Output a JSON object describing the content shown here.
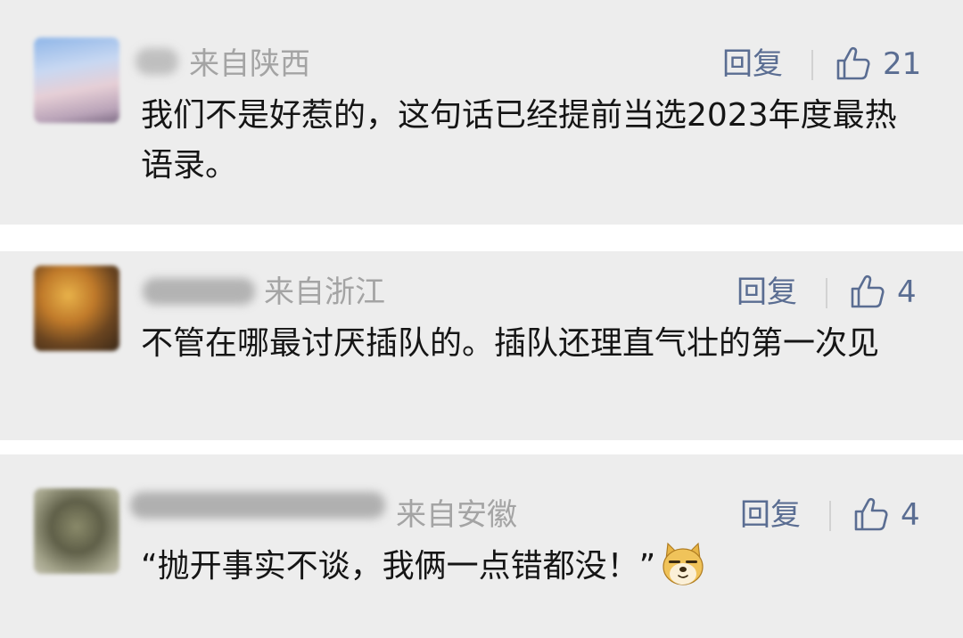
{
  "comments": [
    {
      "location": "来自陕西",
      "reply_label": "回复",
      "like_icon": "thumbs-up-icon",
      "likes": "21",
      "text": "我们不是好惹的，这句话已经提前当选2023年度最热语录。"
    },
    {
      "location": "来自浙江",
      "reply_label": "回复",
      "like_icon": "thumbs-up-icon",
      "likes": "4",
      "text": "不管在哪最讨厌插队的。插队还理直气壮的第一次见"
    },
    {
      "location": "来自安徽",
      "reply_label": "回复",
      "like_icon": "thumbs-up-icon",
      "likes": "4",
      "text": "“抛开事实不谈，我俩一点错都没！”",
      "emoji": "doge-emoji"
    }
  ],
  "colors": {
    "card_bg": "#ededed",
    "location": "#a4a4a4",
    "action": "#5a6d92",
    "body_text": "#151515"
  }
}
